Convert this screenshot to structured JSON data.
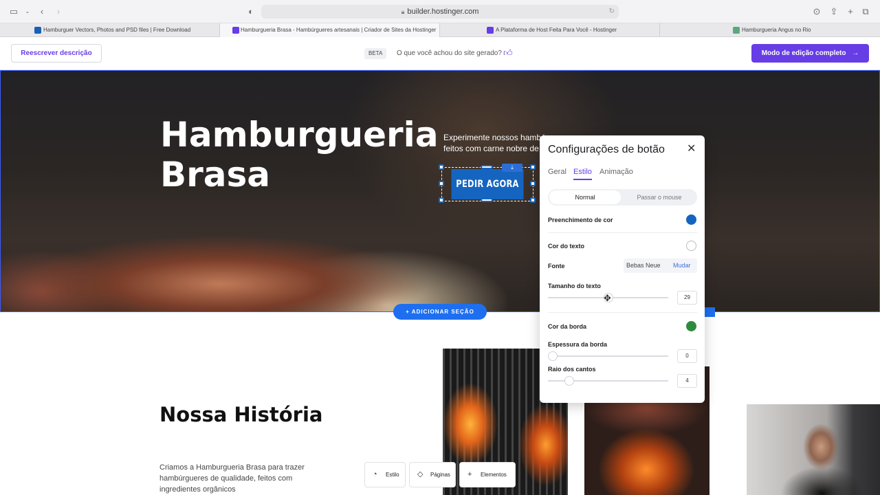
{
  "browser": {
    "url": "builder.hostinger.com",
    "tabs": [
      {
        "title": "Hamburguer Vectors, Photos and PSD files | Free Download",
        "favicon_color": "#1a5fb4"
      },
      {
        "title": "Hamburgueria Brasa - Hambúrgueres artesanais | Criador de Sites da Hostinger",
        "favicon_color": "#673de6"
      },
      {
        "title": "A Plataforma de Host Feita Para Você - Hostinger",
        "favicon_color": "#673de6"
      },
      {
        "title": "Hamburgueria Angus no Rio",
        "favicon_color": "#5ba87d"
      }
    ]
  },
  "topbar": {
    "rewrite_label": "Reescrever descrição",
    "beta_label": "BETA",
    "feedback_question": "O que você achou do site gerado?",
    "full_edit_label": "Modo de edição completo",
    "accent_color": "#673de6"
  },
  "hero": {
    "title_line1": "Hamburgueria",
    "title_line2": "Brasa",
    "subtitle_line1": "Experimente nossos hambúr",
    "subtitle_line2": "feitos com carne nobre de a",
    "cta_label": "PEDIR AGORA",
    "cta_color": "#1565c0",
    "add_section_label": "+ ADICIONAR SEÇÃO"
  },
  "story": {
    "title": "Nossa História",
    "text": "Criamos a Hamburgueria Brasa para trazer hambúrgueres de qualidade, feitos com ingredientes orgânicos"
  },
  "editor_toolbar": {
    "style_label": "Estilo",
    "pages_label": "Páginas",
    "elements_label": "Elementos"
  },
  "settings_panel": {
    "title": "Configurações de botão",
    "tabs": [
      "Geral",
      "Estilo",
      "Animação"
    ],
    "active_tab": "Estilo",
    "state_normal": "Normal",
    "state_hover": "Passar o mouse",
    "fill_label": "Preenchimento de cor",
    "fill_color": "#1565c0",
    "text_color_label": "Cor do texto",
    "text_color": "#ffffff",
    "font_label": "Fonte",
    "font_name": "Bebas Neue",
    "font_change": "Mudar",
    "text_size_label": "Tamanho do texto",
    "text_size": "29",
    "text_size_fraction": 0.5,
    "border_color_label": "Cor da borda",
    "border_color": "#2e8b3e",
    "border_width_label": "Espessura da borda",
    "border_width": "0",
    "border_width_fraction": 0.0,
    "radius_label": "Raio dos cantos",
    "radius": "4",
    "radius_fraction": 0.15
  }
}
